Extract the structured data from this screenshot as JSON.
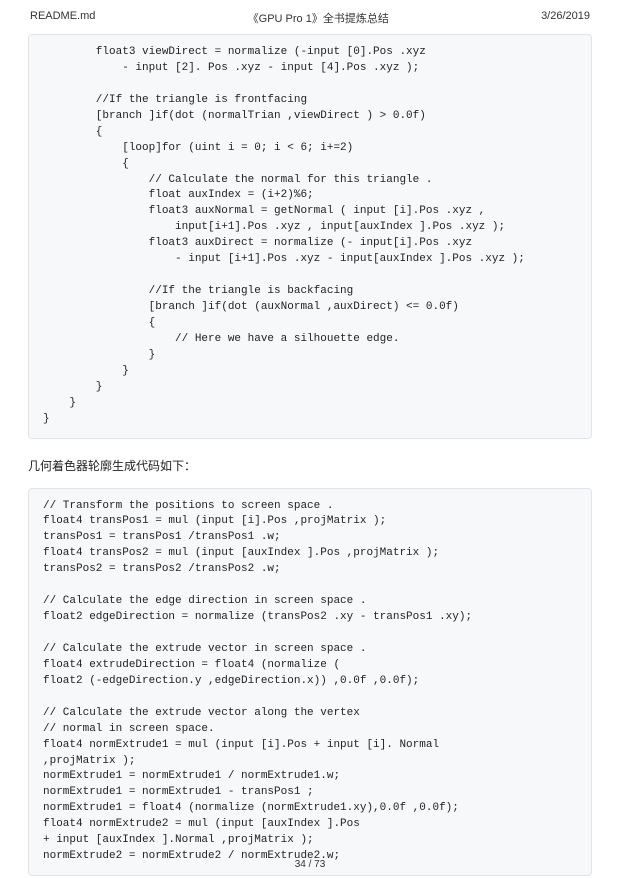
{
  "header": {
    "filename": "README.md",
    "title": "《GPU Pro 1》全书提炼总结",
    "date": "3/26/2019"
  },
  "code1": "        float3 viewDirect = normalize (-input [0].Pos .xyz\n            - input [2]. Pos .xyz - input [4].Pos .xyz );\n\n        //If the triangle is frontfacing\n        [branch ]if(dot (normalTrian ,viewDirect ) > 0.0f)\n        {\n            [loop]for (uint i = 0; i < 6; i+=2)\n            {\n                // Calculate the normal for this triangle .\n                float auxIndex = (i+2)%6;\n                float3 auxNormal = getNormal ( input [i].Pos .xyz ,\n                    input[i+1].Pos .xyz , input[auxIndex ].Pos .xyz );\n                float3 auxDirect = normalize (- input[i].Pos .xyz\n                    - input [i+1].Pos .xyz - input[auxIndex ].Pos .xyz );\n\n                //If the triangle is backfacing\n                [branch ]if(dot (auxNormal ,auxDirect) <= 0.0f)\n                {\n                    // Here we have a silhouette edge.\n                }\n            }\n        }\n    }\n}",
  "prose1": "几何着色器轮廓生成代码如下：",
  "code2": "// Transform the positions to screen space .\nfloat4 transPos1 = mul (input [i].Pos ,projMatrix );\ntransPos1 = transPos1 /transPos1 .w;\nfloat4 transPos2 = mul (input [auxIndex ].Pos ,projMatrix );\ntransPos2 = transPos2 /transPos2 .w;\n\n// Calculate the edge direction in screen space .\nfloat2 edgeDirection = normalize (transPos2 .xy - transPos1 .xy);\n\n// Calculate the extrude vector in screen space .\nfloat4 extrudeDirection = float4 (normalize (\nfloat2 (-edgeDirection.y ,edgeDirection.x)) ,0.0f ,0.0f);\n\n// Calculate the extrude vector along the vertex\n// normal in screen space.\nfloat4 normExtrude1 = mul (input [i].Pos + input [i]. Normal\n,projMatrix );\nnormExtrude1 = normExtrude1 / normExtrude1.w;\nnormExtrude1 = normExtrude1 - transPos1 ;\nnormExtrude1 = float4 (normalize (normExtrude1.xy),0.0f ,0.0f);\nfloat4 normExtrude2 = mul (input [auxIndex ].Pos\n+ input [auxIndex ].Normal ,projMatrix );\nnormExtrude2 = normExtrude2 / normExtrude2.w;",
  "footer": {
    "page": "34 / 73"
  }
}
